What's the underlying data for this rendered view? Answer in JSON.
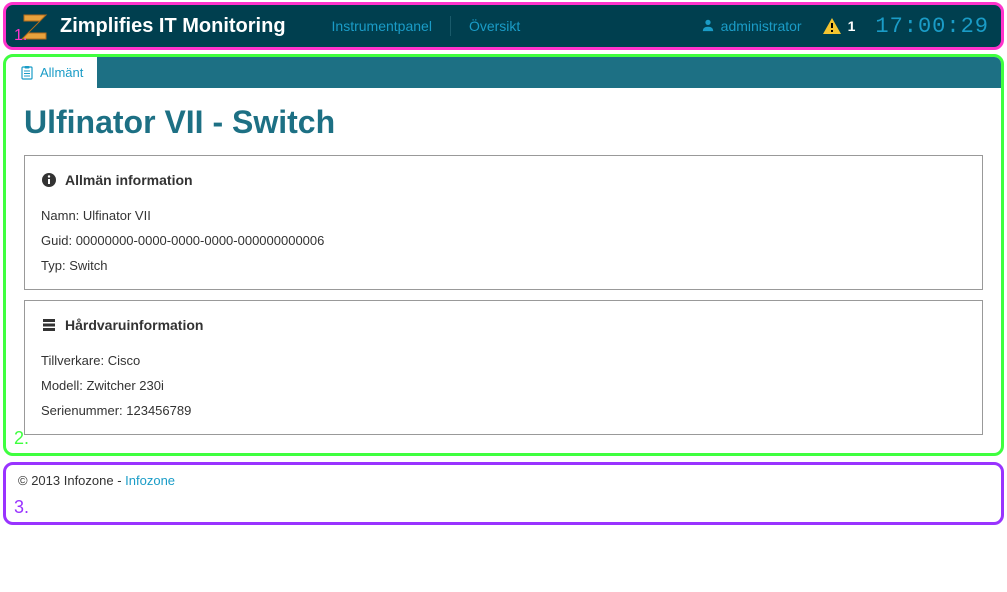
{
  "annotations": {
    "1": "1.",
    "2": "2.",
    "3": "3."
  },
  "header": {
    "app_title": "Zimplifies IT Monitoring",
    "nav": {
      "dashboard": "Instrumentpanel",
      "overview": "Översikt"
    },
    "user_label": "administrator",
    "alert_count": "1",
    "clock": "17:00:29"
  },
  "tab": {
    "general_label": "Allmänt"
  },
  "page": {
    "title": "Ulfinator VII - Switch",
    "general_info": {
      "heading": "Allmän information",
      "name_label": "Namn:",
      "name_value": "Ulfinator VII",
      "guid_label": "Guid:",
      "guid_value": "00000000-0000-0000-0000-000000000006",
      "type_label": "Typ:",
      "type_value": "Switch"
    },
    "hardware_info": {
      "heading": "Hårdvaruinformation",
      "mfr_label": "Tillverkare:",
      "mfr_value": "Cisco",
      "model_label": "Modell:",
      "model_value": "Zwitcher 230i",
      "serial_label": "Serienummer:",
      "serial_value": "123456789"
    }
  },
  "footer": {
    "copyright": "© 2013 Infozone - ",
    "link_text": "Infozone"
  }
}
